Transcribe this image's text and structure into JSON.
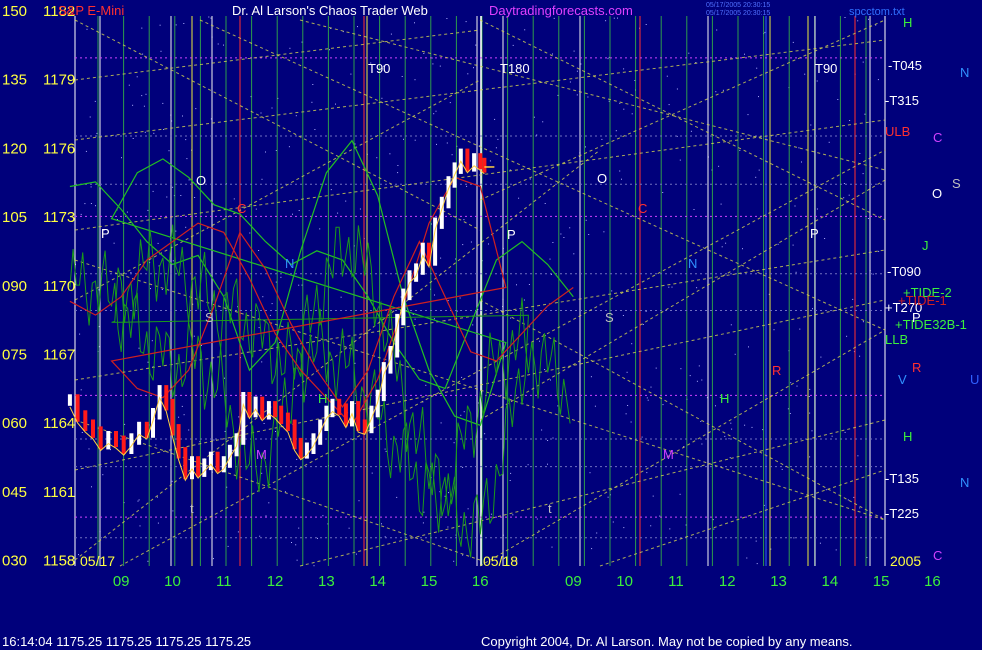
{
  "header": {
    "symbol": "S&P E-Mini",
    "title": "Dr. Al Larson's Chaos Trader Web",
    "site": "Daytradingforecasts.com",
    "stamp_line1": "05/17/2005 20:30:15",
    "stamp_line2": "05/17/2005 20:30:15",
    "file": "spcctom.txt"
  },
  "footer": {
    "quote": "16:14:04  1175.25 1175.25 1175.25 1175.25",
    "copyright": "Copyright 2004, Dr. Al Larson. May not be copied by any means."
  },
  "colors": {
    "background": "#00007b",
    "price_up": "#ffffff",
    "price_down": "#ff1a1a",
    "price_axis": "#ffff40",
    "time_axis": "#3cf03c",
    "vertical_grid": "#3cd03c",
    "yellow_vertical": "#e8e840",
    "red_vertical": "#ff3030",
    "blue_vertical": "#3060ff",
    "white_vertical": "#f0f0f0",
    "diagonal": "#d8d850",
    "flux_green": "#22c022",
    "flux_red": "#d02020",
    "magenta_level": "#d040ff"
  },
  "chart_data": {
    "type": "candlestick",
    "y_left_labels": [
      "150",
      "135",
      "120",
      "105",
      "090",
      "075",
      "060",
      "045",
      "030"
    ],
    "y_price_labels": [
      "1182",
      "1179",
      "1176",
      "1173",
      "1170",
      "1167",
      "1164",
      "1161",
      "1158"
    ],
    "ylim": [
      1158,
      1182
    ],
    "x_ticks": [
      "09",
      "10",
      "11",
      "12",
      "13",
      "14",
      "15",
      "16",
      "09",
      "10",
      "11",
      "12",
      "13",
      "14",
      "15",
      "16"
    ],
    "x_tick_days": [
      0,
      0,
      0,
      0,
      0,
      0,
      0,
      0,
      1,
      1,
      1,
      1,
      1,
      1,
      1,
      1
    ],
    "x_tick_hours": [
      9,
      10,
      11,
      12,
      13,
      14,
      15,
      16,
      9,
      10,
      11,
      12,
      13,
      14,
      15,
      16
    ],
    "date_labels": [
      "05/17",
      "05/18"
    ],
    "year_label": "2005",
    "price_series": [
      {
        "t": 8.0,
        "p": 1165.1
      },
      {
        "t": 8.15,
        "p": 1164.4
      },
      {
        "t": 8.3,
        "p": 1164.0
      },
      {
        "t": 8.45,
        "p": 1163.7
      },
      {
        "t": 8.6,
        "p": 1163.2
      },
      {
        "t": 8.75,
        "p": 1163.5
      },
      {
        "t": 8.9,
        "p": 1163.3
      },
      {
        "t": 9.05,
        "p": 1163.0
      },
      {
        "t": 9.2,
        "p": 1163.4
      },
      {
        "t": 9.35,
        "p": 1163.9
      },
      {
        "t": 9.5,
        "p": 1163.7
      },
      {
        "t": 9.62,
        "p": 1164.5
      },
      {
        "t": 9.75,
        "p": 1165.5
      },
      {
        "t": 9.88,
        "p": 1164.9
      },
      {
        "t": 10.0,
        "p": 1163.8
      },
      {
        "t": 10.12,
        "p": 1162.8
      },
      {
        "t": 10.25,
        "p": 1161.9
      },
      {
        "t": 10.38,
        "p": 1162.4
      },
      {
        "t": 10.5,
        "p": 1162.0
      },
      {
        "t": 10.62,
        "p": 1162.3
      },
      {
        "t": 10.75,
        "p": 1162.6
      },
      {
        "t": 10.88,
        "p": 1162.2
      },
      {
        "t": 11.0,
        "p": 1162.4
      },
      {
        "t": 11.12,
        "p": 1162.9
      },
      {
        "t": 11.25,
        "p": 1163.4
      },
      {
        "t": 11.38,
        "p": 1165.2
      },
      {
        "t": 11.5,
        "p": 1164.6
      },
      {
        "t": 11.62,
        "p": 1165.0
      },
      {
        "t": 11.75,
        "p": 1164.5
      },
      {
        "t": 11.88,
        "p": 1164.8
      },
      {
        "t": 12.0,
        "p": 1164.6
      },
      {
        "t": 12.12,
        "p": 1164.3
      },
      {
        "t": 12.25,
        "p": 1164.0
      },
      {
        "t": 12.38,
        "p": 1163.2
      },
      {
        "t": 12.5,
        "p": 1162.8
      },
      {
        "t": 12.62,
        "p": 1163.0
      },
      {
        "t": 12.75,
        "p": 1163.4
      },
      {
        "t": 12.88,
        "p": 1164.0
      },
      {
        "t": 13.0,
        "p": 1164.6
      },
      {
        "t": 13.12,
        "p": 1164.9
      },
      {
        "t": 13.25,
        "p": 1164.7
      },
      {
        "t": 13.38,
        "p": 1164.2
      },
      {
        "t": 13.5,
        "p": 1164.8
      },
      {
        "t": 13.62,
        "p": 1164.0
      },
      {
        "t": 13.75,
        "p": 1163.9
      },
      {
        "t": 13.88,
        "p": 1164.6
      },
      {
        "t": 14.0,
        "p": 1165.3
      },
      {
        "t": 14.12,
        "p": 1166.5
      },
      {
        "t": 14.25,
        "p": 1167.2
      },
      {
        "t": 14.38,
        "p": 1168.6
      },
      {
        "t": 14.5,
        "p": 1169.7
      },
      {
        "t": 14.62,
        "p": 1170.5
      },
      {
        "t": 14.75,
        "p": 1170.8
      },
      {
        "t": 14.88,
        "p": 1171.7
      },
      {
        "t": 15.0,
        "p": 1171.2
      },
      {
        "t": 15.12,
        "p": 1172.8
      },
      {
        "t": 15.25,
        "p": 1173.7
      },
      {
        "t": 15.38,
        "p": 1174.6
      },
      {
        "t": 15.5,
        "p": 1175.2
      },
      {
        "t": 15.62,
        "p": 1175.8
      },
      {
        "t": 15.75,
        "p": 1175.3
      },
      {
        "t": 15.88,
        "p": 1175.6
      },
      {
        "t": 16.0,
        "p": 1175.4
      },
      {
        "t": 16.08,
        "p": 1175.25
      }
    ],
    "flux_green": [
      {
        "t": 8.0,
        "v": 112
      },
      {
        "t": 8.5,
        "v": 113
      },
      {
        "t": 9.0,
        "v": 107
      },
      {
        "t": 9.5,
        "v": 100
      },
      {
        "t": 10.0,
        "v": 95
      },
      {
        "t": 10.5,
        "v": 97
      },
      {
        "t": 11.0,
        "v": 88
      },
      {
        "t": 11.5,
        "v": 72
      },
      {
        "t": 12.0,
        "v": 78
      },
      {
        "t": 12.5,
        "v": 98
      },
      {
        "t": 13.0,
        "v": 115
      },
      {
        "t": 13.5,
        "v": 122
      },
      {
        "t": 14.0,
        "v": 110
      },
      {
        "t": 14.5,
        "v": 88
      },
      {
        "t": 15.0,
        "v": 72
      },
      {
        "t": 15.5,
        "v": 62
      },
      {
        "t": 16.0,
        "v": 60
      },
      {
        "t": 16.5,
        "v": 78
      },
      {
        "t": 17.0,
        "v": 105
      },
      {
        "t": 17.5,
        "v": 115
      },
      {
        "t": 18.0,
        "v": 118
      },
      {
        "t": 18.5,
        "v": 114
      },
      {
        "t": 19.0,
        "v": 108
      },
      {
        "t": 19.5,
        "v": 106
      },
      {
        "t": 20.0,
        "v": 100
      },
      {
        "t": 20.5,
        "v": 95
      },
      {
        "t": 21.0,
        "v": 98
      },
      {
        "t": 21.5,
        "v": 96
      },
      {
        "t": 22.0,
        "v": 88
      },
      {
        "t": 22.5,
        "v": 78
      },
      {
        "t": 23.0,
        "v": 70
      },
      {
        "t": 23.5,
        "v": 68
      },
      {
        "t": 24.0,
        "v": 82
      },
      {
        "t": 24.5,
        "v": 96
      },
      {
        "t": 25.0,
        "v": 100
      },
      {
        "t": 25.5,
        "v": 95
      },
      {
        "t": 26.0,
        "v": 88
      }
    ],
    "flux_red": [
      {
        "t": 8.0,
        "v": 87
      },
      {
        "t": 8.5,
        "v": 84
      },
      {
        "t": 9.0,
        "v": 88
      },
      {
        "t": 9.5,
        "v": 96
      },
      {
        "t": 10.0,
        "v": 100
      },
      {
        "t": 10.5,
        "v": 104
      },
      {
        "t": 11.0,
        "v": 102
      },
      {
        "t": 11.5,
        "v": 92
      },
      {
        "t": 12.0,
        "v": 80
      },
      {
        "t": 12.5,
        "v": 72
      },
      {
        "t": 13.0,
        "v": 66
      },
      {
        "t": 13.5,
        "v": 60
      },
      {
        "t": 14.0,
        "v": 70
      },
      {
        "t": 14.5,
        "v": 86
      },
      {
        "t": 15.0,
        "v": 104
      },
      {
        "t": 15.5,
        "v": 114
      },
      {
        "t": 16.0,
        "v": 112
      },
      {
        "t": 16.5,
        "v": 90
      },
      {
        "t": 17.0,
        "v": 74
      },
      {
        "t": 17.5,
        "v": 68
      },
      {
        "t": 18.0,
        "v": 66
      },
      {
        "t": 18.5,
        "v": 72
      },
      {
        "t": 19.0,
        "v": 86
      },
      {
        "t": 19.5,
        "v": 102
      },
      {
        "t": 20.0,
        "v": 94
      },
      {
        "t": 20.5,
        "v": 82
      },
      {
        "t": 21.0,
        "v": 72
      },
      {
        "t": 21.5,
        "v": 64
      },
      {
        "t": 22.0,
        "v": 72
      },
      {
        "t": 22.5,
        "v": 88
      },
      {
        "t": 23.0,
        "v": 100
      },
      {
        "t": 23.5,
        "v": 88
      },
      {
        "t": 24.0,
        "v": 76
      },
      {
        "t": 24.5,
        "v": 74
      },
      {
        "t": 25.0,
        "v": 80
      },
      {
        "t": 25.5,
        "v": 86
      },
      {
        "t": 26.0,
        "v": 90
      }
    ],
    "right_labels": [
      {
        "text": "H",
        "color": "#3cf03c"
      },
      {
        "text": "-T045",
        "color": "#ffffff"
      },
      {
        "text": "N",
        "color": "#3090ff"
      },
      {
        "text": "-T315",
        "color": "#ffffff"
      },
      {
        "text": "ULB",
        "color": "#ff3030"
      },
      {
        "text": "C",
        "color": "#d040ff"
      },
      {
        "text": "O",
        "color": "#ffffff"
      },
      {
        "text": "S",
        "color": "#c0c0c0"
      },
      {
        "text": "J",
        "color": "#3cf03c"
      },
      {
        "text": "-T090",
        "color": "#ffffff"
      },
      {
        "text": "+TIDE-2",
        "color": "#3cf03c"
      },
      {
        "text": "+T270",
        "color": "#ffffff"
      },
      {
        "text": "+TIDE-1",
        "color": "#d02020"
      },
      {
        "text": "P",
        "color": "#ffffff"
      },
      {
        "text": "+TIDE32B-1",
        "color": "#3cf03c"
      },
      {
        "text": "LLB",
        "color": "#3cf03c"
      },
      {
        "text": "V",
        "color": "#3090ff"
      },
      {
        "text": "R",
        "color": "#ff3030"
      },
      {
        "text": "U",
        "color": "#3060ff"
      },
      {
        "text": "H",
        "color": "#3cf03c"
      },
      {
        "text": "-T135",
        "color": "#ffffff"
      },
      {
        "text": "N",
        "color": "#3090ff"
      },
      {
        "text": "-T225",
        "color": "#ffffff"
      },
      {
        "text": "C",
        "color": "#d040ff"
      }
    ],
    "plot_markers": [
      {
        "text": "T90",
        "color": "#ffffff"
      },
      {
        "text": "T180",
        "color": "#ffffff"
      },
      {
        "text": "T90",
        "color": "#ffffff"
      },
      {
        "text": "O",
        "color": "#ffffff"
      },
      {
        "text": "O",
        "color": "#ffffff"
      },
      {
        "text": "P",
        "color": "#ffffff"
      },
      {
        "text": "P",
        "color": "#ffffff"
      },
      {
        "text": "P",
        "color": "#ffffff"
      },
      {
        "text": "C",
        "color": "#ff3030"
      },
      {
        "text": "C",
        "color": "#ff3030"
      },
      {
        "text": "N",
        "color": "#3090ff"
      },
      {
        "text": "N",
        "color": "#3090ff"
      },
      {
        "text": "S",
        "color": "#c0c0c0"
      },
      {
        "text": "S",
        "color": "#c0c0c0"
      },
      {
        "text": "M",
        "color": "#d040ff"
      },
      {
        "text": "M",
        "color": "#d040ff"
      },
      {
        "text": "H",
        "color": "#3cf03c"
      },
      {
        "text": "H",
        "color": "#3cf03c"
      },
      {
        "text": "t",
        "color": "#c0c0c0"
      },
      {
        "text": "t",
        "color": "#c0c0c0"
      },
      {
        "text": "R",
        "color": "#ff3030"
      }
    ]
  }
}
